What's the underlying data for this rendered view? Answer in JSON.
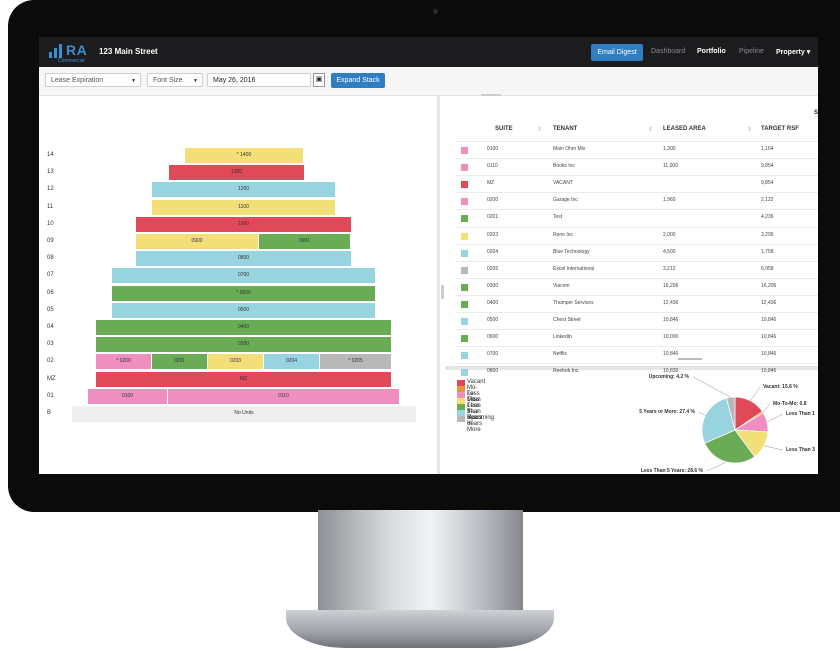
{
  "app": {
    "logo_text": "RA",
    "logo_sub": "Commercial",
    "address": "123 Main Street"
  },
  "nav": {
    "email_digest": "Email Digest",
    "links": [
      "Dashboard",
      "Portfolio",
      "Pipeline",
      "Property"
    ],
    "active": "Portfolio",
    "property_caret": "▾"
  },
  "toolbar": {
    "mode_select": "Lease Expiration",
    "font_select": "Font Size",
    "date_value": "May 26, 2016",
    "expand_label": "Expand Stack"
  },
  "colors": {
    "vacant": "#e0495a",
    "mtm": "#e8973a",
    "lt1": "#ef8fbf",
    "lt3": "#f3df78",
    "lt5": "#6aac55",
    "gt5": "#97d4e0",
    "upcoming": "#b8b8b8",
    "nounits": "#efefef",
    "accent": "#2f7ec1"
  },
  "stack": {
    "floors": [
      {
        "label": "14",
        "blocks": [
          {
            "s": "* 1400",
            "c": "lt3"
          }
        ]
      },
      {
        "label": "13",
        "blocks": [
          {
            "s": "1300",
            "c": "vacant"
          }
        ]
      },
      {
        "label": "12",
        "blocks": [
          {
            "s": "1200",
            "c": "gt5"
          }
        ]
      },
      {
        "label": "11",
        "blocks": [
          {
            "s": "1100",
            "c": "lt3"
          }
        ]
      },
      {
        "label": "10",
        "blocks": [
          {
            "s": "1000",
            "c": "vacant"
          }
        ]
      },
      {
        "label": "09",
        "blocks": [
          {
            "s": "0900",
            "c": "lt3"
          },
          {
            "s": "0901",
            "c": "lt5"
          }
        ]
      },
      {
        "label": "08",
        "blocks": [
          {
            "s": "0800",
            "c": "gt5"
          }
        ]
      },
      {
        "label": "07",
        "blocks": [
          {
            "s": "0700",
            "c": "gt5"
          }
        ]
      },
      {
        "label": "06",
        "blocks": [
          {
            "s": "* 0600",
            "c": "lt5"
          }
        ]
      },
      {
        "label": "05",
        "blocks": [
          {
            "s": "0500",
            "c": "gt5"
          }
        ]
      },
      {
        "label": "04",
        "blocks": [
          {
            "s": "0400",
            "c": "lt5"
          }
        ]
      },
      {
        "label": "03",
        "blocks": [
          {
            "s": "0300",
            "c": "lt5"
          }
        ]
      },
      {
        "label": "02",
        "blocks": [
          {
            "s": "* 0200",
            "c": "lt1"
          },
          {
            "s": "0201",
            "c": "lt5"
          },
          {
            "s": "0203",
            "c": "lt3"
          },
          {
            "s": "0204",
            "c": "gt5"
          },
          {
            "s": "* 0205",
            "c": "upcoming"
          }
        ]
      },
      {
        "label": "MZ",
        "blocks": [
          {
            "s": "MZ",
            "c": "vacant"
          }
        ]
      },
      {
        "label": "01",
        "blocks": [
          {
            "s": "0100",
            "c": "lt1"
          },
          {
            "s": "0110",
            "c": "lt1"
          }
        ]
      },
      {
        "label": "B",
        "blocks": [
          {
            "s": "No Units",
            "c": "nounits"
          }
        ]
      }
    ]
  },
  "table": {
    "headers": [
      "SUITE",
      "TENANT",
      "LEASED AREA",
      "TARGET RSF"
    ],
    "corner_letter": "S",
    "rows": [
      {
        "c": "lt1",
        "suite": "0100",
        "tenant": "Main Ohm Mix",
        "leased": "1,300",
        "target": "1,164"
      },
      {
        "c": "lt1",
        "suite": "0110",
        "tenant": "Books Inc",
        "leased": "11,000",
        "target": "9,854"
      },
      {
        "c": "vacant",
        "suite": "MZ",
        "tenant": "VACANT",
        "leased": "",
        "target": "9,854"
      },
      {
        "c": "lt1",
        "suite": "0200",
        "tenant": "Garage Inc",
        "leased": "1,960",
        "target": "2,122"
      },
      {
        "c": "lt5",
        "suite": "0201",
        "tenant": "Test",
        "leased": "",
        "target": "4,236"
      },
      {
        "c": "lt3",
        "suite": "0203",
        "tenant": "Reno Inc",
        "leased": "2,000",
        "target": "3,295"
      },
      {
        "c": "gt5",
        "suite": "0204",
        "tenant": "Blue Technology",
        "leased": "4,500",
        "target": "1,758"
      },
      {
        "c": "upcoming",
        "suite": "0205",
        "tenant": "Excel International",
        "leased": "3,212",
        "target": "6,958"
      },
      {
        "c": "lt5",
        "suite": "0300",
        "tenant": "Viacom",
        "leased": "16,206",
        "target": "16,206"
      },
      {
        "c": "lt5",
        "suite": "0400",
        "tenant": "Thumper Services",
        "leased": "12,436",
        "target": "12,436"
      },
      {
        "c": "gt5",
        "suite": "0500",
        "tenant": "Chest Street",
        "leased": "10,846",
        "target": "10,846"
      },
      {
        "c": "lt5",
        "suite": "0600",
        "tenant": "LinkedIn",
        "leased": "10,000",
        "target": "10,846"
      },
      {
        "c": "gt5",
        "suite": "0700",
        "tenant": "Netflix",
        "leased": "10,846",
        "target": "10,846"
      },
      {
        "c": "gt5",
        "suite": "0800",
        "tenant": "Reebok Inc.",
        "leased": "10,830",
        "target": "10,846"
      }
    ]
  },
  "legend": [
    {
      "label": "Vacant",
      "c": "vacant"
    },
    {
      "label": "Mo-To-Mo",
      "c": "mtm"
    },
    {
      "label": "Less Than 1 Year",
      "c": "lt1"
    },
    {
      "label": "Less Than 3 Years",
      "c": "lt3"
    },
    {
      "label": "Less Than 5 Years",
      "c": "lt5"
    },
    {
      "label": "5 Years or More",
      "c": "gt5"
    },
    {
      "label": "Upcoming",
      "c": "upcoming"
    }
  ],
  "chart_data": {
    "type": "pie",
    "slices": [
      {
        "name": "Vacant",
        "value": 15.6,
        "c": "vacant"
      },
      {
        "name": "Mo-To-Mo",
        "value": 0.8,
        "c": "mtm"
      },
      {
        "name": "Less Than 1 Year",
        "value": 9.6,
        "c": "lt1"
      },
      {
        "name": "Less Than 3 Years",
        "value": 14.0,
        "c": "lt3"
      },
      {
        "name": "Less Than 5 Years",
        "value": 28.6,
        "c": "lt5"
      },
      {
        "name": "5 Years or More",
        "value": 27.4,
        "c": "gt5"
      },
      {
        "name": "Upcoming",
        "value": 4.2,
        "c": "upcoming"
      }
    ],
    "labels": {
      "upcoming": "Upcoming: 4.2 %",
      "vacant": "Vacant: 15.6 %",
      "mtm": "Mo-To-Mo: 0.8",
      "lt1": "Less Than 1",
      "lt3": "Less Than 3",
      "lt5": "Less Than 5 Years: 28.6 %",
      "gt5": "5 Years or More: 27.4 %"
    }
  }
}
